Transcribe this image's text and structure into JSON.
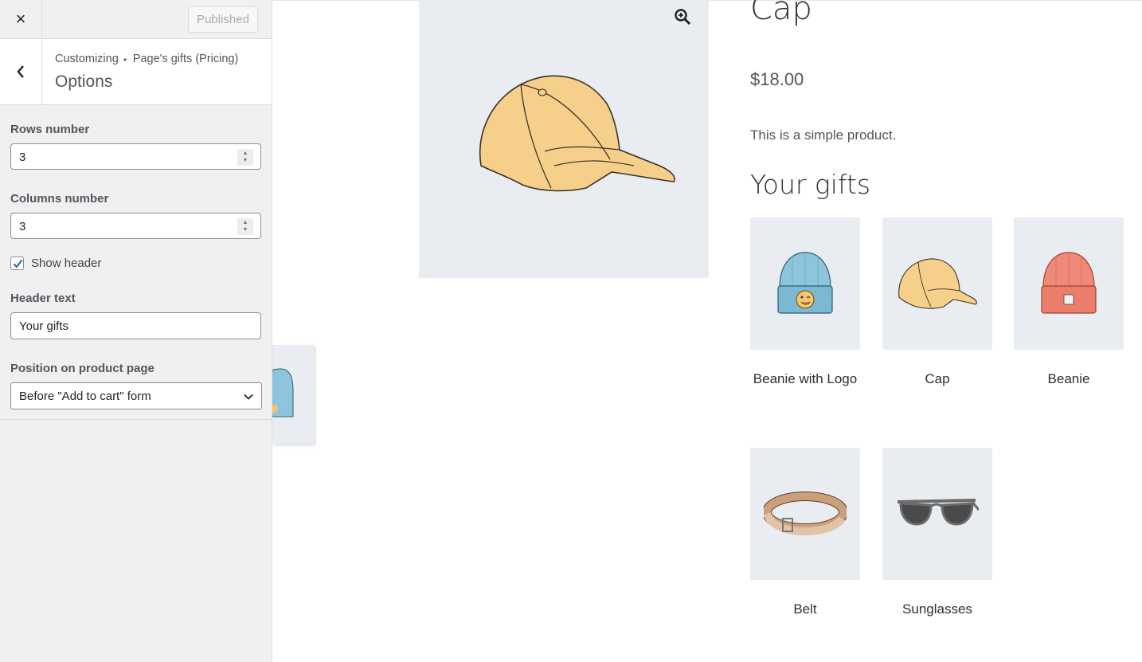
{
  "topbar": {
    "close_label": "×",
    "publish_label": "Published"
  },
  "section": {
    "breadcrumb_root": "Customizing",
    "breadcrumb_sep": "▸",
    "breadcrumb_parent": "Page's gifts (Pricing)",
    "title": "Options"
  },
  "controls": {
    "rows": {
      "label": "Rows number",
      "value": "3"
    },
    "columns": {
      "label": "Columns number",
      "value": "3"
    },
    "show_header": {
      "label": "Show header",
      "checked": true
    },
    "header_text": {
      "label": "Header text",
      "value": "Your gifts"
    },
    "position": {
      "label": "Position on product page",
      "selected": "Before \"Add to cart\" form"
    }
  },
  "product": {
    "title": "Cap",
    "price": "$18.00",
    "description": "This is a simple product.",
    "gifts_title": "Your gifts",
    "gifts": [
      {
        "name": "Beanie with Logo",
        "icon": "beanie-blue-logo"
      },
      {
        "name": "Cap",
        "icon": "cap-yellow"
      },
      {
        "name": "Beanie",
        "icon": "beanie-red"
      },
      {
        "name": "Belt",
        "icon": "belt-brown"
      },
      {
        "name": "Sunglasses",
        "icon": "sunglasses-gray"
      }
    ]
  },
  "colors": {
    "sidebar_bg": "#f0f0f1",
    "product_bg": "#e9edf1",
    "accent": "#2271b1"
  }
}
